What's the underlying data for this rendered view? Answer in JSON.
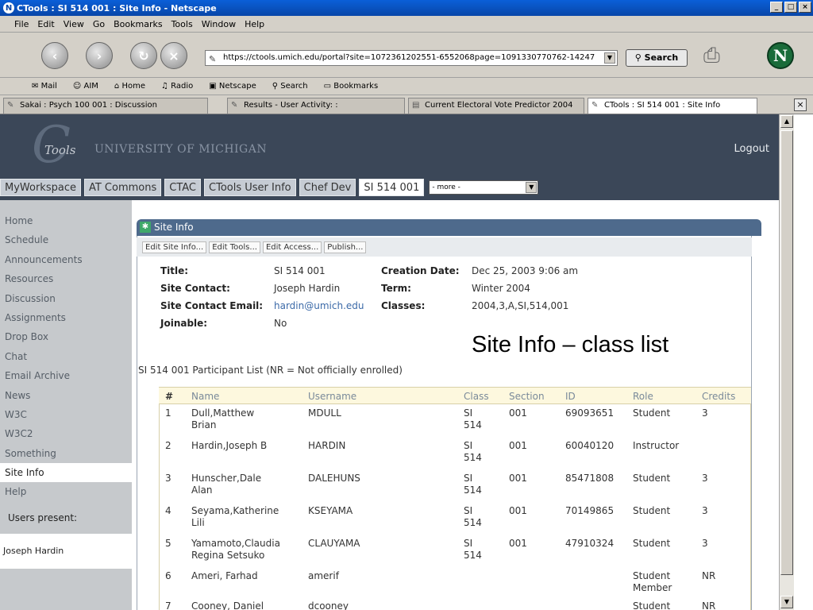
{
  "window": {
    "title": "CTools : SI 514 001 : Site Info - Netscape"
  },
  "menu": [
    "File",
    "Edit",
    "View",
    "Go",
    "Bookmarks",
    "Tools",
    "Window",
    "Help"
  ],
  "nav": {
    "url": "https://ctools.umich.edu/portal?site=1072361202551-6552068page=1091330770762-14247",
    "search_label": "Search"
  },
  "personal_toolbar": [
    "Mail",
    "AIM",
    "Home",
    "Radio",
    "Netscape",
    "Search",
    "Bookmarks"
  ],
  "browser_tabs": [
    "Sakai : Psych 100 001 : Discussion",
    "Results - User Activity: :",
    "Current Electoral Vote Predictor 2004",
    "CTools : SI 514 001 : Site Info"
  ],
  "header": {
    "logo_text": "Tools",
    "university": "UNIVERSITY OF MICHIGAN",
    "logout": "Logout"
  },
  "site_tabs": [
    "MyWorkspace",
    "AT Commons",
    "CTAC",
    "CTools User Info",
    "Chef Dev",
    "SI 514 001"
  ],
  "more_select": "- more -",
  "left_nav": [
    "Home",
    "Schedule",
    "Announcements",
    "Resources",
    "Discussion",
    "Assignments",
    "Drop Box",
    "Chat",
    "Email Archive",
    "News",
    "W3C",
    "W3C2",
    "Something",
    "Site Info",
    "Help"
  ],
  "users_present": {
    "label": "Users present:",
    "user": "Joseph Hardin"
  },
  "panel": {
    "title": "Site Info",
    "actions": [
      "Edit Site Info...",
      "Edit Tools...",
      "Edit Access...",
      "Publish..."
    ]
  },
  "site_info": {
    "title_label": "Title:",
    "title_value": "SI 514 001",
    "contact_label": "Site Contact:",
    "contact_value": "Joseph Hardin",
    "email_label": "Site Contact Email:",
    "email_value": "hardin@umich.edu",
    "joinable_label": "Joinable:",
    "joinable_value": "No",
    "created_label": "Creation Date:",
    "created_value": "Dec 25, 2003 9:06 am",
    "term_label": "Term:",
    "term_value": "Winter 2004",
    "classes_label": "Classes:",
    "classes_value": "2004,3,A,SI,514,001"
  },
  "overlay_title": "Site Info – class list",
  "participant_list_title": "SI 514 001 Participant List (NR = Not officially enrolled)",
  "table": {
    "headers": [
      "#",
      "Name",
      "Username",
      "Class",
      "Section",
      "ID",
      "Role",
      "Credits"
    ],
    "rows": [
      {
        "num": "1",
        "name1": "Dull,Matthew",
        "name2": "Brian",
        "user": "MDULL",
        "class1": "SI",
        "class2": "514",
        "section": "001",
        "id": "69093651",
        "role1": "Student",
        "role2": "",
        "credits": "3"
      },
      {
        "num": "2",
        "name1": "Hardin,Joseph B",
        "name2": "",
        "user": "HARDIN",
        "class1": "SI",
        "class2": "514",
        "section": "001",
        "id": "60040120",
        "role1": "Instructor",
        "role2": "",
        "credits": ""
      },
      {
        "num": "3",
        "name1": "Hunscher,Dale",
        "name2": "Alan",
        "user": "DALEHUNS",
        "class1": "SI",
        "class2": "514",
        "section": "001",
        "id": "85471808",
        "role1": "Student",
        "role2": "",
        "credits": "3"
      },
      {
        "num": "4",
        "name1": "Seyama,Katherine",
        "name2": "Lili",
        "user": "KSEYAMA",
        "class1": "SI",
        "class2": "514",
        "section": "001",
        "id": "70149865",
        "role1": "Student",
        "role2": "",
        "credits": "3"
      },
      {
        "num": "5",
        "name1": "Yamamoto,Claudia",
        "name2": "Regina Setsuko",
        "user": "CLAUYAMA",
        "class1": "SI",
        "class2": "514",
        "section": "001",
        "id": "47910324",
        "role1": "Student",
        "role2": "",
        "credits": "3"
      },
      {
        "num": "6",
        "name1": "Ameri, Farhad",
        "name2": "",
        "user": "amerif",
        "class1": "",
        "class2": "",
        "section": "",
        "id": "",
        "role1": "Student",
        "role2": "Member",
        "credits": "NR"
      },
      {
        "num": "7",
        "name1": "Cooney, Daniel",
        "name2": "",
        "user": "dcooney",
        "class1": "",
        "class2": "",
        "section": "",
        "id": "",
        "role1": "Student",
        "role2": "",
        "credits": "NR"
      }
    ]
  }
}
